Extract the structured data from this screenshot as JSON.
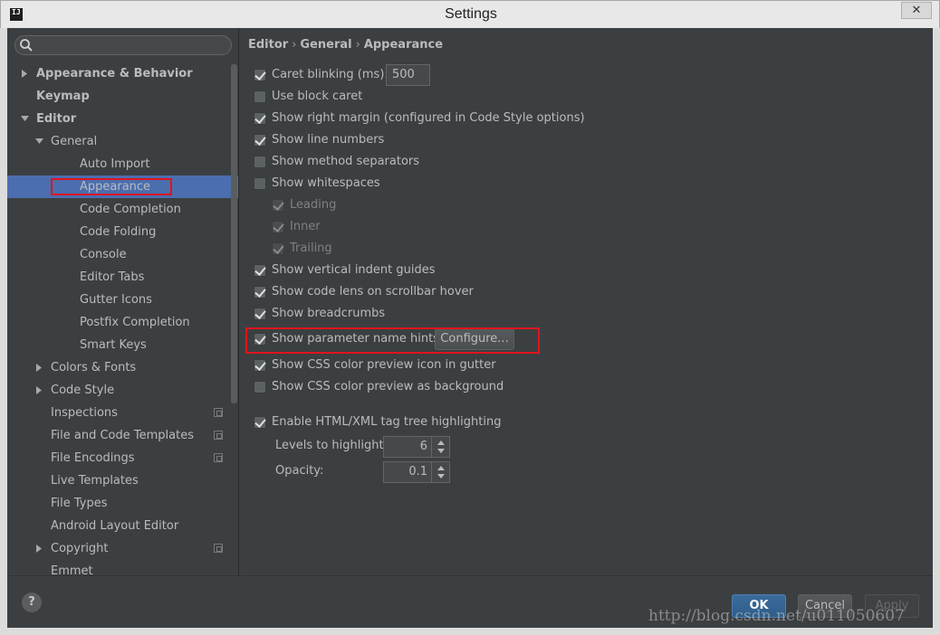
{
  "window": {
    "title": "Settings",
    "app_icon_text": "IJ",
    "close_label": "✕"
  },
  "search": {
    "value": ""
  },
  "tree": [
    {
      "label": "Appearance & Behavior",
      "bold": true,
      "arrow": "right",
      "level": 0
    },
    {
      "label": "Keymap",
      "bold": true,
      "arrow": "",
      "level": 0
    },
    {
      "label": "Editor",
      "bold": true,
      "arrow": "down",
      "level": 0
    },
    {
      "label": "General",
      "bold": false,
      "arrow": "down",
      "level": 1
    },
    {
      "label": "Auto Import",
      "bold": false,
      "arrow": "",
      "level": 2
    },
    {
      "label": "Appearance",
      "bold": false,
      "arrow": "",
      "level": 2,
      "selected": true
    },
    {
      "label": "Code Completion",
      "bold": false,
      "arrow": "",
      "level": 2
    },
    {
      "label": "Code Folding",
      "bold": false,
      "arrow": "",
      "level": 2
    },
    {
      "label": "Console",
      "bold": false,
      "arrow": "",
      "level": 2
    },
    {
      "label": "Editor Tabs",
      "bold": false,
      "arrow": "",
      "level": 2
    },
    {
      "label": "Gutter Icons",
      "bold": false,
      "arrow": "",
      "level": 2
    },
    {
      "label": "Postfix Completion",
      "bold": false,
      "arrow": "",
      "level": 2
    },
    {
      "label": "Smart Keys",
      "bold": false,
      "arrow": "",
      "level": 2
    },
    {
      "label": "Colors & Fonts",
      "bold": false,
      "arrow": "right",
      "level": 1
    },
    {
      "label": "Code Style",
      "bold": false,
      "arrow": "right",
      "level": 1
    },
    {
      "label": "Inspections",
      "bold": false,
      "arrow": "",
      "level": 1,
      "project": true
    },
    {
      "label": "File and Code Templates",
      "bold": false,
      "arrow": "",
      "level": 1,
      "project": true
    },
    {
      "label": "File Encodings",
      "bold": false,
      "arrow": "",
      "level": 1,
      "project": true
    },
    {
      "label": "Live Templates",
      "bold": false,
      "arrow": "",
      "level": 1
    },
    {
      "label": "File Types",
      "bold": false,
      "arrow": "",
      "level": 1
    },
    {
      "label": "Android Layout Editor",
      "bold": false,
      "arrow": "",
      "level": 1
    },
    {
      "label": "Copyright",
      "bold": false,
      "arrow": "right",
      "level": 1,
      "project": true
    },
    {
      "label": "Emmet",
      "bold": false,
      "arrow": "",
      "level": 1
    }
  ],
  "breadcrumb": {
    "items": [
      "Editor",
      "General",
      "Appearance"
    ],
    "separator": "›"
  },
  "options": {
    "caret_blinking": {
      "label": "Caret blinking (ms):",
      "checked": true,
      "value": "500"
    },
    "use_block_caret": {
      "label": "Use block caret",
      "checked": false
    },
    "show_right_margin": {
      "label": "Show right margin (configured in Code Style options)",
      "checked": true
    },
    "show_line_numbers": {
      "label": "Show line numbers",
      "checked": true
    },
    "show_method_separators": {
      "label": "Show method separators",
      "checked": false
    },
    "show_whitespaces": {
      "label": "Show whitespaces",
      "checked": false
    },
    "leading": {
      "label": "Leading",
      "checked": true
    },
    "inner": {
      "label": "Inner",
      "checked": true
    },
    "trailing": {
      "label": "Trailing",
      "checked": true
    },
    "show_vertical_indent_guides": {
      "label": "Show vertical indent guides",
      "checked": true
    },
    "show_code_lens": {
      "label": "Show code lens on scrollbar hover",
      "checked": true
    },
    "show_breadcrumbs": {
      "label": "Show breadcrumbs",
      "checked": true
    },
    "show_parameter_name_hints": {
      "label": "Show parameter name hints",
      "checked": true,
      "button_label": "Configure..."
    },
    "show_css_color_preview_icon": {
      "label": "Show CSS color preview icon in gutter",
      "checked": true
    },
    "show_css_color_preview_bg": {
      "label": "Show CSS color preview as background",
      "checked": false
    },
    "enable_tag_tree": {
      "label": "Enable HTML/XML tag tree highlighting",
      "checked": true
    },
    "levels_to_highlight": {
      "label": "Levels to highlight:",
      "value": "6"
    },
    "opacity": {
      "label": "Opacity:",
      "value": "0.1"
    }
  },
  "footer": {
    "help_label": "?",
    "ok_label": "OK",
    "cancel_label": "Cancel",
    "apply_label": "Apply"
  },
  "watermark": "http://blog.csdn.net/u011050607",
  "colors": {
    "background": "#3c3f41",
    "selection": "#4b6eaf",
    "highlight_annotation": "#e0141e",
    "text": "#bbbbbb"
  }
}
